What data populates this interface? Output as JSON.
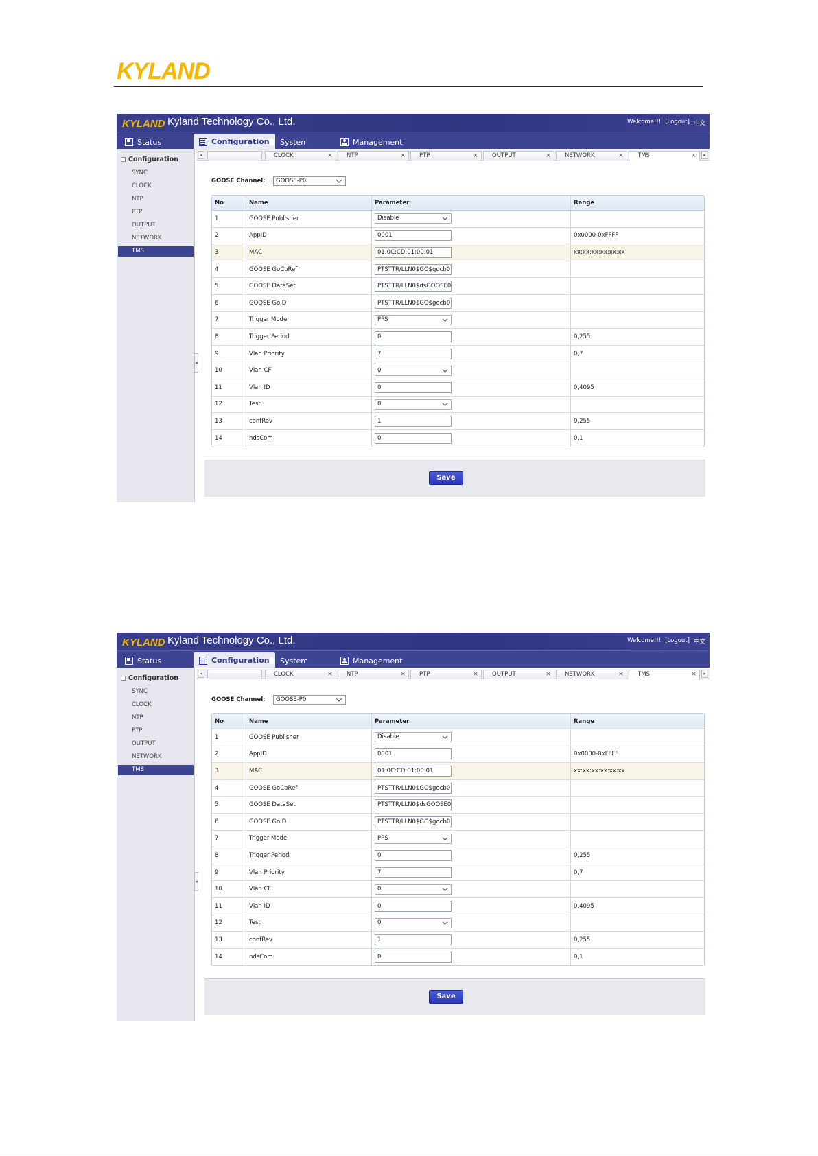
{
  "doc": {
    "logo_text": "KYLAND"
  },
  "app": {
    "logo_text": "KYLAND",
    "title": "Kyland Technology Co., Ltd.",
    "welcome": "Welcome!!!",
    "logout": "[Logout]",
    "lang": "中文",
    "colors": {
      "header": "#2f3582",
      "accent": "#3d4492",
      "save": "#2a35b5",
      "logo_yellow": "#f2b700"
    }
  },
  "menu": [
    {
      "label": "Status",
      "icon": "status-icon"
    },
    {
      "label": "Configuration",
      "icon": "configuration-icon"
    },
    {
      "label": "System",
      "icon": "home-icon"
    },
    {
      "label": "Management",
      "icon": "user-icon"
    }
  ],
  "sidebar": {
    "heading": "Configuration",
    "items": [
      "SYNC",
      "CLOCK",
      "NTP",
      "PTP",
      "OUTPUT",
      "NETWORK",
      "TMS"
    ],
    "active": "TMS"
  },
  "tabs": [
    "",
    "CLOCK",
    "NTP",
    "PTP",
    "OUTPUT",
    "NETWORK",
    "TMS"
  ],
  "channel": {
    "label": "GOOSE Channel:",
    "value": "GOOSE-P0"
  },
  "table": {
    "headers": [
      "No",
      "Name",
      "Parameter",
      "Range"
    ],
    "rows": [
      {
        "no": "1",
        "name": "GOOSE Publisher",
        "kind": "select",
        "value": "Disable",
        "range": ""
      },
      {
        "no": "2",
        "name": "AppID",
        "kind": "input",
        "value": "0001",
        "range": "0x0000-0xFFFF"
      },
      {
        "no": "3",
        "name": "MAC",
        "kind": "input",
        "value": "01:0C:CD:01:00:01",
        "range": "xx:xx:xx:xx:xx:xx"
      },
      {
        "no": "4",
        "name": "GOOSE GoCbRef",
        "kind": "input",
        "value": "PTSTTR/LLN0$GO$gocb0",
        "range": ""
      },
      {
        "no": "5",
        "name": "GOOSE DataSet",
        "kind": "input",
        "value": "PTSTTR/LLN0$dsGOOSE0",
        "range": ""
      },
      {
        "no": "6",
        "name": "GOOSE GoID",
        "kind": "input",
        "value": "PTSTTR/LLN0$GO$gocb0",
        "range": ""
      },
      {
        "no": "7",
        "name": "Trigger Mode",
        "kind": "select",
        "value": "PPS",
        "range": ""
      },
      {
        "no": "8",
        "name": "Trigger Period",
        "kind": "input",
        "value": "0",
        "range": "0,255"
      },
      {
        "no": "9",
        "name": "Vlan Priority",
        "kind": "input",
        "value": "7",
        "range": "0,7"
      },
      {
        "no": "10",
        "name": "Vlan CFI",
        "kind": "select",
        "value": "0",
        "range": ""
      },
      {
        "no": "11",
        "name": "Vlan ID",
        "kind": "input",
        "value": "0",
        "range": "0,4095"
      },
      {
        "no": "12",
        "name": "Test",
        "kind": "select",
        "value": "0",
        "range": ""
      },
      {
        "no": "13",
        "name": "confRev",
        "kind": "input",
        "value": "1",
        "range": "0,255"
      },
      {
        "no": "14",
        "name": "ndsCom",
        "kind": "input",
        "value": "0",
        "range": "0,1"
      }
    ]
  },
  "save_label": "Save"
}
